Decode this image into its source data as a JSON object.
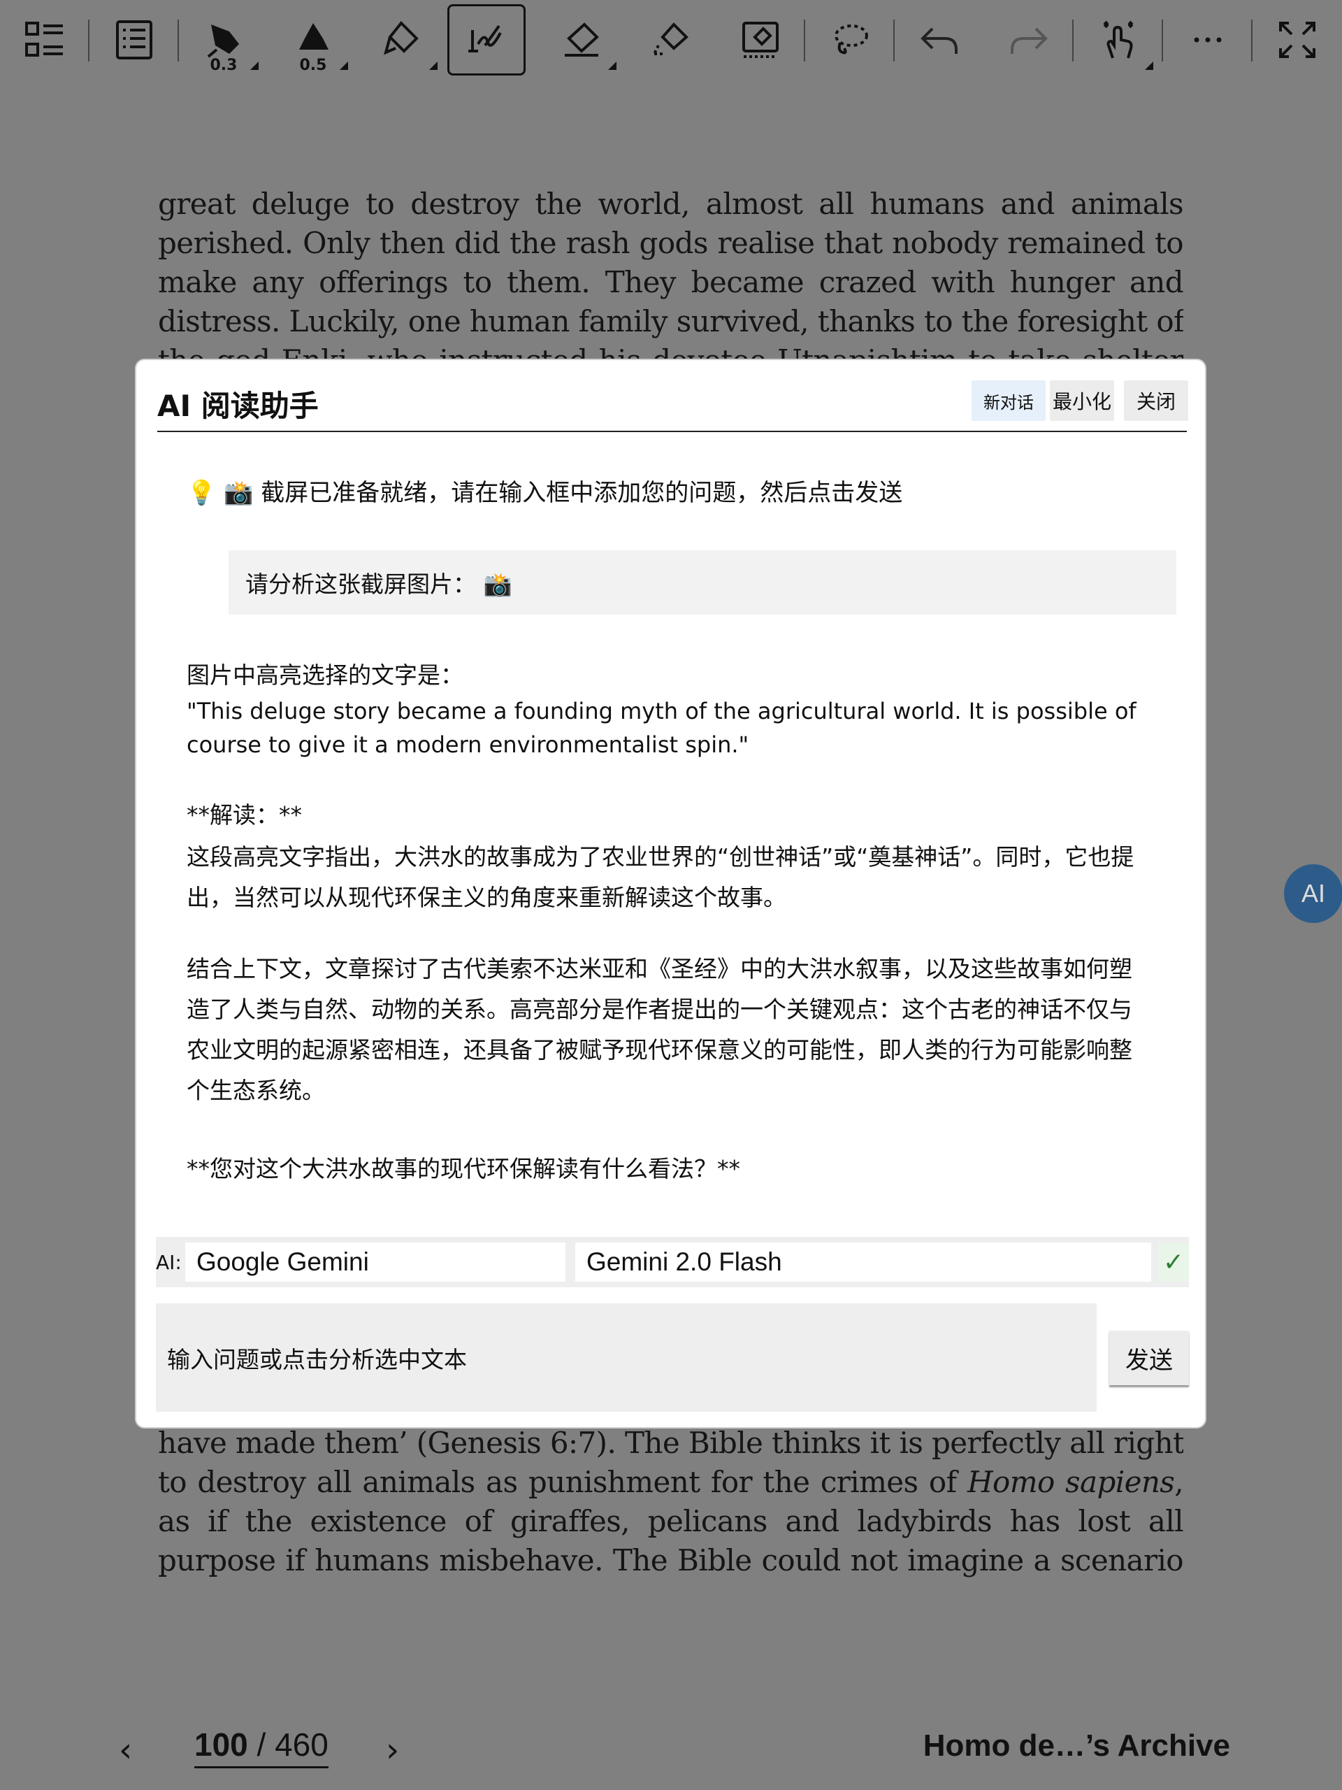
{
  "toolbar": {
    "tools": [
      {
        "name": "layout-icon"
      },
      {
        "name": "list-icon"
      },
      {
        "name": "pen-icon",
        "sub": "0.3"
      },
      {
        "name": "brush-icon",
        "sub": "0.5"
      },
      {
        "name": "highlighter-icon"
      },
      {
        "name": "handwriting-icon",
        "active": true
      },
      {
        "name": "eraser-icon"
      },
      {
        "name": "lasso-eraser-icon"
      },
      {
        "name": "clear-page-icon"
      },
      {
        "name": "lasso-icon"
      },
      {
        "name": "undo-icon"
      },
      {
        "name": "redo-icon"
      },
      {
        "name": "touch-icon"
      },
      {
        "name": "more-icon"
      },
      {
        "name": "fullscreen-icon"
      }
    ]
  },
  "book": {
    "top_lines": [
      "great deluge to destroy the world, almost all humans and animals",
      "perished. Only then did the rash gods realise that nobody remained to",
      "make any offerings to them. They became crazed with hunger and",
      "distress. Luckily, one human family survived, thanks to the foresight of",
      "the god Enki, who instructed his devotee Utnapishtim to take shelter"
    ],
    "bottom_lines": [
      "have made them’ (Genesis 6:7). The Bible thinks it is perfectly all right",
      "to destroy all animals as punishment for the crimes of Homo sapiens,",
      "as if the existence of giraffes, pelicans and ladybirds has lost all",
      "purpose if humans misbehave. The Bible could not imagine a scenario"
    ]
  },
  "dialog": {
    "title": "AI 阅读助手",
    "buttons": {
      "new_chat": "新对话",
      "minimize": "最小化",
      "close": "关闭"
    },
    "hint": "💡 📸 截屏已准备就绪，请在输入框中添加您的问题，然后点击发送",
    "user_message": "请分析这张截屏图片：  📸",
    "reply": {
      "intro": "图片中高亮选择的文字是：",
      "quote": "\"This deluge story became a founding myth of the agricultural world. It is possible of course to give it a modern environmentalist spin.\"",
      "heading": "**解读：**",
      "para1": "这段高亮文字指出，大洪水的故事成为了农业世界的“创世神话”或“奠基神话”。同时，它也提出，当然可以从现代环保主义的角度来重新解读这个故事。",
      "para2": "结合上下文，文章探讨了古代美索不达米亚和《圣经》中的大洪水叙事，以及这些故事如何塑造了人类与自然、动物的关系。高亮部分是作者提出的一个关键观点：这个古老的神话不仅与农业文明的起源紧密相连，还具备了被赋予现代环保意义的可能性，即人类的行为可能影响整个生态系统。",
      "question": "**您对这个大洪水故事的现代环保解读有什么看法？**"
    },
    "model": {
      "label": "AI:",
      "provider": "Google Gemini",
      "model": "Gemini 2.0 Flash",
      "check": "✓"
    },
    "input_placeholder": "输入问题或点击分析选中文本",
    "send": "发送"
  },
  "fab": "AI",
  "nav": {
    "prev": "‹",
    "next": "›",
    "current_page": "100",
    "separator": " / ",
    "total_pages": "460",
    "book_title": "Homo de…’s Archive"
  }
}
